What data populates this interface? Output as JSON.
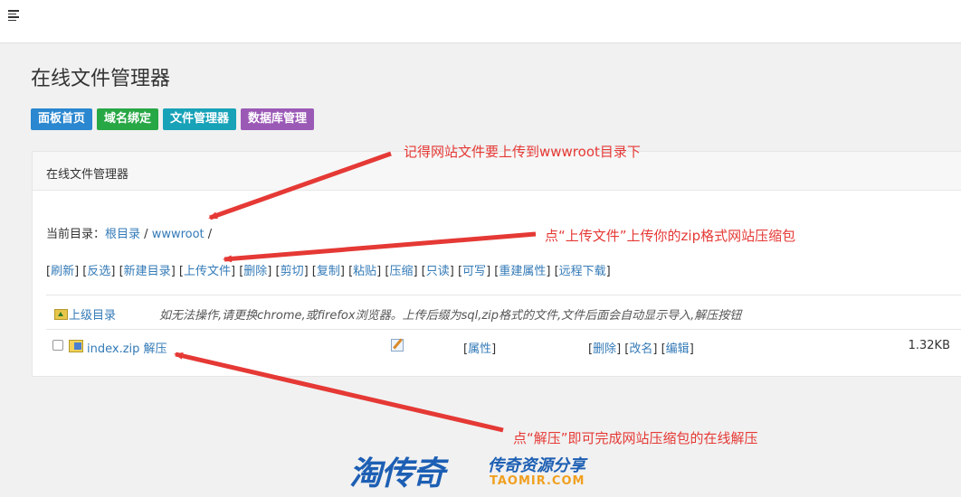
{
  "header": {
    "menu_icon": "hamburger-icon"
  },
  "page_title": "在线文件管理器",
  "nav_buttons": [
    {
      "label": "面板首页",
      "color": "#2a87d0"
    },
    {
      "label": "域名绑定",
      "color": "#28a745"
    },
    {
      "label": "文件管理器",
      "color": "#17a2b8"
    },
    {
      "label": "数据库管理",
      "color": "#9b59b6"
    }
  ],
  "panel": {
    "heading": "在线文件管理器",
    "breadcrumb": {
      "prefix": "当前目录：",
      "root": "根目录",
      "sep1": " / ",
      "dir": "wwwroot",
      "sep2": " /"
    },
    "toolbar": [
      "刷新",
      "反选",
      "新建目录",
      "上传文件",
      "删除",
      "剪切",
      "复制",
      "粘贴",
      "压缩",
      "只读",
      "可写",
      "重建属性",
      "远程下载"
    ],
    "parent_row": {
      "label": "上级目录",
      "note": "如无法操作,请更换chrome,或firefox浏览器。上传后缀为sql,zip格式的文件,文件后面会自动显示导入,解压按钮"
    },
    "file_row": {
      "name": "index.zip",
      "extract": "解压",
      "attr": "属性",
      "ops": [
        "删除",
        "改名",
        "编辑"
      ],
      "size": "1.32KB"
    }
  },
  "annotations": {
    "a1": "记得网站文件要上传到wwwroot目录下",
    "a2": "点“上传文件”上传你的zip格式网站压缩包",
    "a3": "点“解压”即可完成网站压缩包的在线解压",
    "color": "#e53935"
  },
  "watermark": {
    "main": "淘传奇",
    "sub": "传奇资源分享",
    "domain": "TAOMIR.COM"
  }
}
